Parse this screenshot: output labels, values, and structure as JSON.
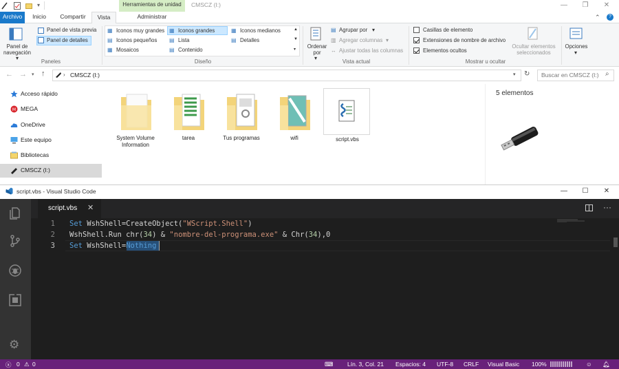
{
  "explorer": {
    "context_tab": "Herramientas de unidad",
    "window_title": "CMSCZ (I:)",
    "tabs": [
      "Archivo",
      "Inicio",
      "Compartir",
      "Vista",
      "Administrar"
    ],
    "ribbon": {
      "paneles": {
        "panel_navegacion": "Panel de navegación",
        "vista_previa": "Panel de vista previa",
        "detalles": "Panel de detalles",
        "label": "Paneles"
      },
      "diseno": {
        "items": [
          "Iconos muy grandes",
          "Iconos grandes",
          "Iconos medianos",
          "Iconos pequeños",
          "Lista",
          "Detalles",
          "Mosaicos",
          "Contenido"
        ],
        "label": "Diseño"
      },
      "vista_actual": {
        "ordenar": "Ordenar por",
        "agrupar": "Agrupar por",
        "agregar_columnas": "Agregar columnas",
        "ajustar": "Ajustar todas las columnas",
        "label": "Vista actual"
      },
      "mostrar": {
        "casillas": "Casillas de elemento",
        "extensiones": "Extensiones de nombre de archivo",
        "ocultos": "Elementos ocultos",
        "ocultar_sel": "Ocultar elementos seleccionados",
        "label": "Mostrar u ocultar"
      },
      "opciones": "Opciones"
    },
    "address": "CMSCZ (I:)",
    "search_placeholder": "Buscar en CMSCZ (I:)",
    "nav": [
      "Acceso rápido",
      "MEGA",
      "OneDrive",
      "Este equipo",
      "Bibliotecas",
      "CMSCZ (I:)"
    ],
    "files": [
      "System Volume Information",
      "tarea",
      "Tus programas",
      "wifi",
      "script.vbs"
    ],
    "item_count": "5 elementos"
  },
  "vscode": {
    "window_title": "script.vbs - Visual Studio Code",
    "tab": "script.vbs",
    "line_numbers": [
      "1",
      "2",
      "3"
    ],
    "code": {
      "l1": {
        "kw": "Set",
        "a": " WshShell=CreateObject(",
        "s": "\"WScript.Shell\"",
        "b": ")"
      },
      "l2": {
        "a": "WshShell.Run chr(",
        "n1": "34",
        "b": ") & ",
        "s": "\"nombre-del-programa.exe\"",
        "c": " & Chr(",
        "n2": "34",
        "d": "),0"
      },
      "l3": {
        "kw": "Set",
        "a": " WshShell=",
        "sel": "Nothing"
      }
    },
    "status": {
      "errors": "0",
      "warnings": "0",
      "position": "Lín. 3, Col. 21",
      "spaces": "Espacios: 4",
      "encoding": "UTF-8",
      "eol": "CRLF",
      "language": "Visual Basic",
      "zoom": "100%"
    }
  }
}
